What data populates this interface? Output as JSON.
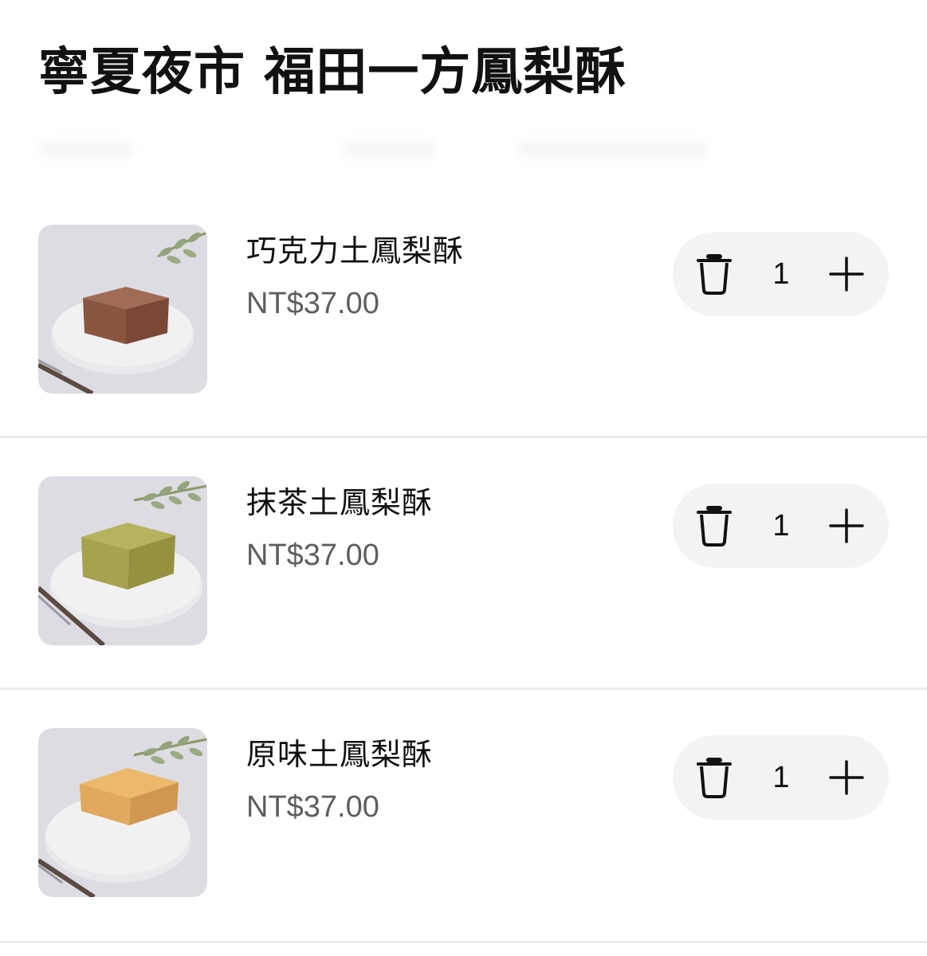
{
  "store": {
    "title": "寧夏夜市 福田一方鳳梨酥"
  },
  "cart": {
    "items": [
      {
        "name": "巧克力土鳳梨酥",
        "price": "NT$37.00",
        "quantity": "1",
        "thumbnail": "chocolate-pineapple-cake-photo",
        "cake_color": "#8b5640"
      },
      {
        "name": "抹茶土鳳梨酥",
        "price": "NT$37.00",
        "quantity": "1",
        "thumbnail": "matcha-pineapple-cake-photo",
        "cake_color": "#a6a24e"
      },
      {
        "name": "原味土鳳梨酥",
        "price": "NT$37.00",
        "quantity": "1",
        "thumbnail": "original-pineapple-cake-photo",
        "cake_color": "#e0a95d"
      }
    ]
  },
  "icons": {
    "remove": "trash-icon",
    "add": "plus-icon"
  },
  "colors": {
    "stepper_background": "#f3f3f3",
    "price_text": "#5e5e5e",
    "divider": "#ececec"
  }
}
